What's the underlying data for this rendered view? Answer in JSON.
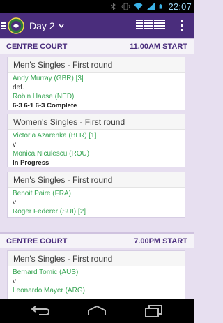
{
  "status_bar": {
    "time": "22:07",
    "icons": [
      "bluetooth-icon",
      "vibrate-icon",
      "wifi-icon",
      "signal-icon",
      "battery-icon"
    ]
  },
  "action_bar": {
    "title": "Day 2",
    "sponsor": "IBM",
    "colors": {
      "background": "#4a2d7c"
    }
  },
  "courts": [
    {
      "name": "CENTRE COURT",
      "time": "11.00AM START",
      "matches": [
        {
          "title": "Men's Singles - First round",
          "player1": "Andy Murray (GBR) [3]",
          "separator": "def.",
          "player2": "Robin Haase (NED)",
          "result": "6-3 6-1 6-3 Complete"
        },
        {
          "title": "Women's Singles - First round",
          "player1": "Victoria Azarenka (BLR) [1]",
          "separator": "v",
          "player2": "Monica Niculescu (ROU)",
          "result": "In Progress"
        },
        {
          "title": "Men's Singles - First round",
          "player1": "Benoit Paire (FRA)",
          "separator": "v",
          "player2": "Roger Federer (SUI) [2]"
        }
      ]
    },
    {
      "name": "CENTRE COURT",
      "time": "7.00PM START",
      "matches": [
        {
          "title": "Men's Singles - First round",
          "player1": "Bernard Tomic (AUS)",
          "separator": "v",
          "player2": "Leonardo Mayer (ARG)"
        }
      ]
    }
  ],
  "nav_bar": {
    "buttons": [
      "back-icon",
      "home-icon",
      "recent-apps-icon"
    ]
  },
  "colors": {
    "accent": "#4a2d7c",
    "player_text": "#37a553",
    "page_background": "#e7dff0"
  }
}
